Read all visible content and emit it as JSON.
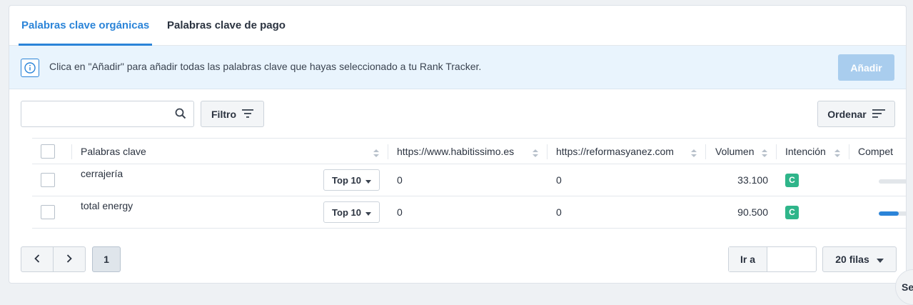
{
  "tabs": {
    "organic": "Palabras clave orgánicas",
    "paid": "Palabras clave de pago"
  },
  "info": {
    "text": "Clica en \"Añadir\" para añadir todas las palabras clave que hayas seleccionado a tu Rank Tracker.",
    "add_label": "Añadir"
  },
  "search": {
    "placeholder": "",
    "value": ""
  },
  "toolbar": {
    "filter_label": "Filtro",
    "sort_label": "Ordenar"
  },
  "table": {
    "headers": {
      "keyword": "Palabras clave",
      "site1": "https://www.habitissimo.es",
      "site2": "https://reformasyanez.com",
      "volume": "Volumen",
      "intent": "Intención",
      "competition": "Compet"
    },
    "rows": [
      {
        "keyword": "cerrajería",
        "top": "Top 10",
        "site1": "0",
        "site2": "0",
        "volume": "33.100",
        "intent": "C",
        "competition": 0.0
      },
      {
        "keyword": "total energy",
        "top": "Top 10",
        "site1": "0",
        "site2": "0",
        "volume": "90.500",
        "intent": "C",
        "competition": 0.7
      }
    ]
  },
  "pagination": {
    "current_page": "1",
    "goto_label": "Ir a",
    "goto_value": "",
    "rows_label": "20 filas"
  },
  "corner_chip": "Se",
  "colors": {
    "accent": "#2b84d8",
    "info_bg": "#e9f4fd",
    "intent_badge": "#2fb58a",
    "add_button_disabled": "#a9cdee"
  }
}
